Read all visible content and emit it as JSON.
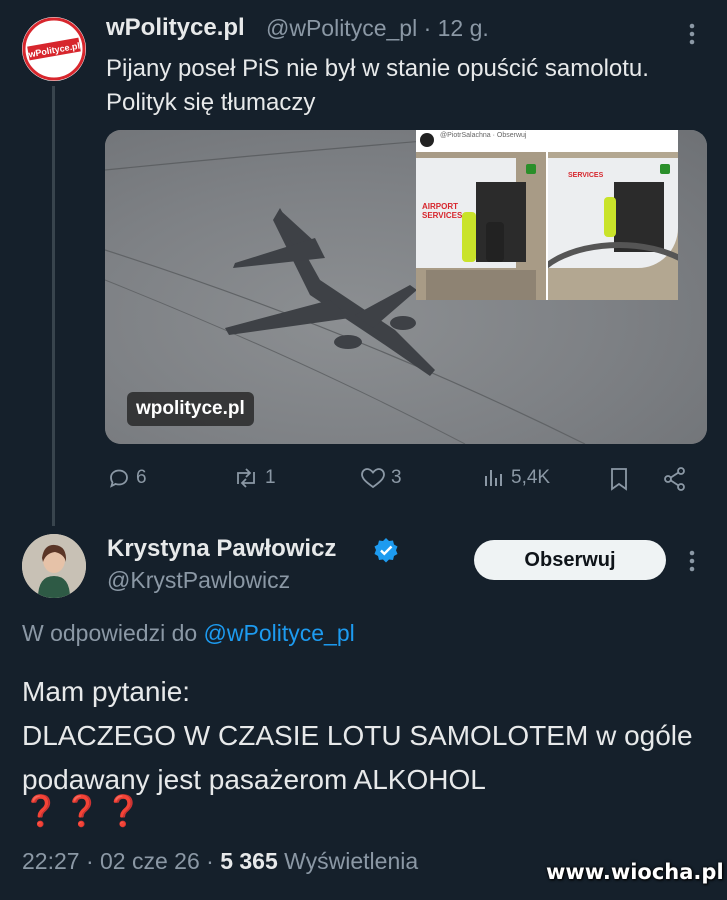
{
  "tweet1": {
    "author_name": "wPolityce.pl",
    "handle": "@wPolityce_pl",
    "time": "· 12 g.",
    "avatar_text": "wPolityce.pl",
    "text": "Pijany poseł PiS nie był w stanie opuścić samolotu. Polityk się tłumaczy",
    "media_watermark": "wpolityce.pl",
    "inset_header": "@PiotrSalachna · Obserwuj",
    "inset_van_text": "AIRPORT SERVICES",
    "stats": {
      "replies": "6",
      "reposts": "1",
      "likes": "3",
      "views": "5,4K"
    }
  },
  "tweet2": {
    "author_name": "Krystyna Pawłowicz",
    "handle": "@KrystPawlowicz",
    "follow_label": "Obserwuj",
    "reply_prefix": "W odpowiedzi do",
    "reply_handle": "@wPolityce_pl",
    "text_line1": "Mam pytanie:",
    "text_line2": "DLACZEGO W CZASIE LOTU SAMOLOTEM w ogóle podawany jest pasażerom ALKOHOL",
    "emoji": "❓❓❓",
    "time": "22:27 · 02 cze 26 ·",
    "views_count": "5 365",
    "views_label": "Wyświetlenia"
  },
  "site_watermark": "www.wiocha.pl",
  "colors": {
    "background": "#15202b",
    "accent": "#1d9bf0",
    "secondary_text": "#8b98a5",
    "brand_red": "#d7262d"
  }
}
